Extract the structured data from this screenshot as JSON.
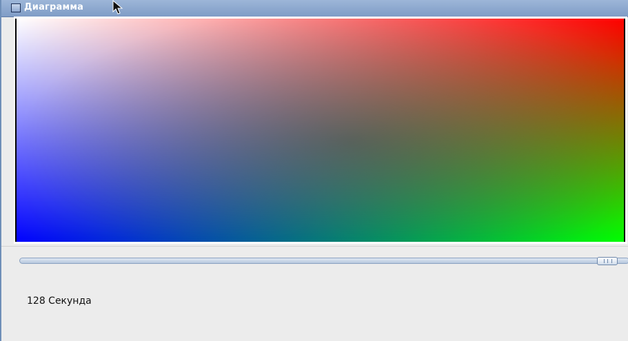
{
  "window": {
    "title": "Диаграмма"
  },
  "icons": {
    "window_icon": "window-icon",
    "cursor": "mouse-pointer-icon"
  },
  "canvas": {
    "corner_colors": {
      "top_left": "#ffffff",
      "top_right": "#ff0000",
      "bottom_left": "#0000ff",
      "bottom_right": "#00ff00"
    }
  },
  "slider": {
    "position_fraction": 0.96
  },
  "status": {
    "time_text": "128 Секунда"
  }
}
